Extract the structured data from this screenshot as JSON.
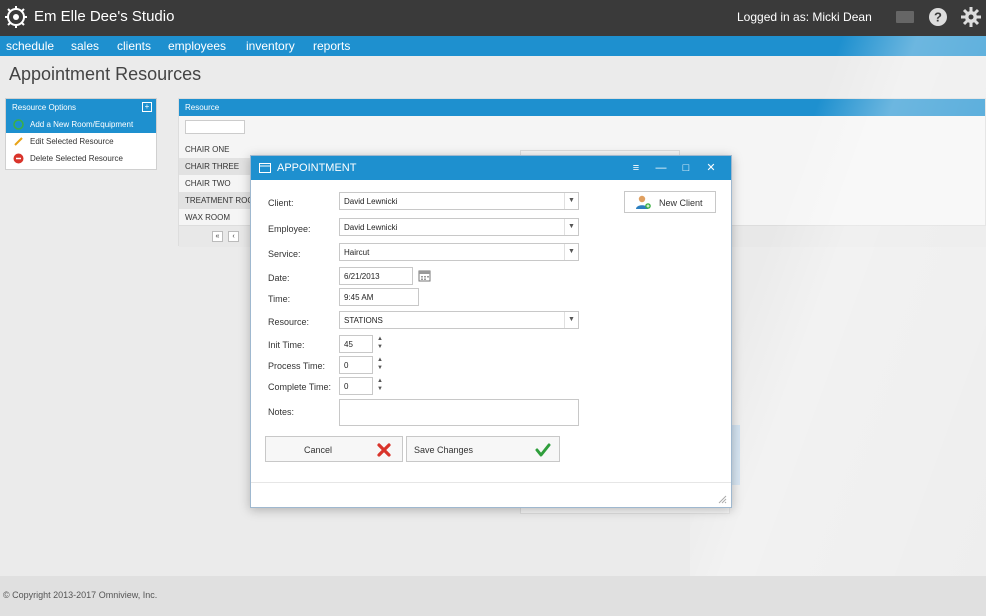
{
  "app": {
    "title": "Em Elle Dee's Studio",
    "logged_in": "Logged in as: Micki Dean"
  },
  "nav": {
    "items": [
      "schedule",
      "sales",
      "clients",
      "employees",
      "inventory",
      "reports"
    ]
  },
  "page": {
    "title": "Appointment Resources"
  },
  "resource_options": {
    "header": "Resource Options",
    "collapse": "+",
    "items": [
      {
        "label": "Add a New Room/Equipment",
        "icon": "add-icon",
        "active": true
      },
      {
        "label": "Edit Selected Resource",
        "icon": "pencil-icon",
        "active": false
      },
      {
        "label": "Delete Selected Resource",
        "icon": "delete-icon",
        "active": false
      }
    ]
  },
  "resource_grid": {
    "header": "Resource",
    "rows": [
      "CHAIR ONE",
      "CHAIR THREE",
      "CHAIR TWO",
      "TREATMENT ROC",
      "WAX ROOM"
    ],
    "pager": [
      "«",
      "‹"
    ]
  },
  "dialog": {
    "title": "APPOINTMENT",
    "controls": {
      "menu": "≡",
      "minimize": "—",
      "maximize": "□",
      "close": "✕"
    },
    "fields": {
      "client": {
        "label": "Client:",
        "value": "David Lewnicki"
      },
      "employee": {
        "label": "Employee:",
        "value": "David Lewnicki"
      },
      "service": {
        "label": "Service:",
        "value": "Haircut"
      },
      "date": {
        "label": "Date:",
        "value": "6/21/2013"
      },
      "time": {
        "label": "Time:",
        "value": "9:45 AM"
      },
      "resource": {
        "label": "Resource:",
        "value": "STATIONS"
      },
      "init_time": {
        "label": "Init Time:",
        "value": "45"
      },
      "process_time": {
        "label": "Process Time:",
        "value": "0"
      },
      "complete_time": {
        "label": "Complete Time:",
        "value": "0"
      },
      "notes": {
        "label": "Notes:",
        "value": ""
      }
    },
    "new_client_label": "New Client",
    "cancel_label": "Cancel",
    "save_label": "Save Changes",
    "spin_up": "▲",
    "spin_down": "▼",
    "dropdown_arrow": "▼"
  },
  "footer": {
    "copyright": "© Copyright 2013-2017 Omniview, Inc."
  },
  "colors": {
    "accent": "#1e90cf",
    "topbar": "#3a3a3a",
    "cancel": "#d9342b",
    "save": "#2f9e3c"
  }
}
